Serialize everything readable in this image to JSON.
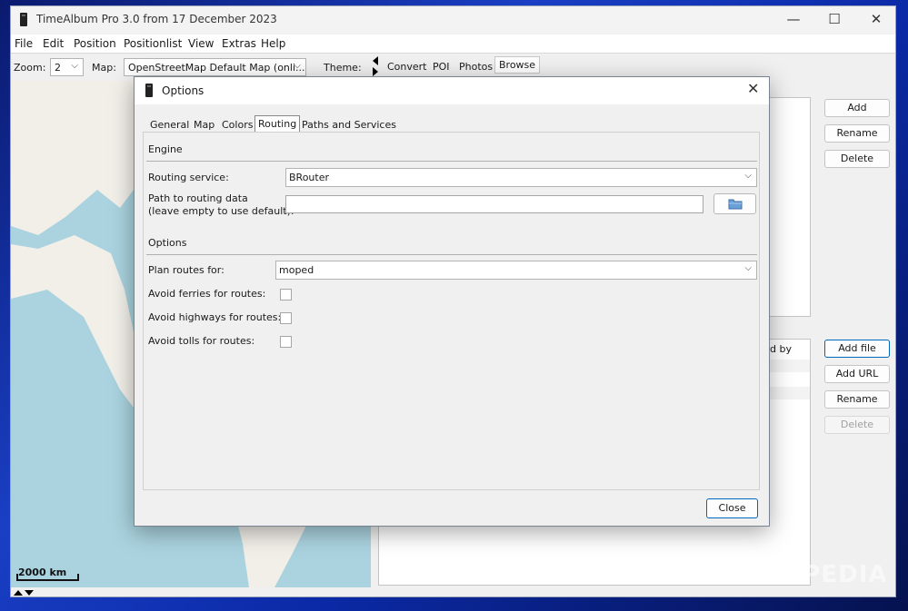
{
  "window": {
    "title": "TimeAlbum Pro 3.0 from 17 December 2023",
    "minimize_glyph": "—",
    "maximize_glyph": "☐",
    "close_glyph": "✕"
  },
  "menu": [
    "File",
    "Edit",
    "Position",
    "Positionlist",
    "View",
    "Extras",
    "Help"
  ],
  "toolbar": {
    "zoom_label": "Zoom:",
    "zoom_value": "2",
    "map_label": "Map:",
    "map_value": "OpenStreetMap Default Map (onli...",
    "theme_label": "Theme:",
    "tabs": [
      "Convert",
      "POI",
      "Photos",
      "Browse"
    ],
    "active_tab": "Browse"
  },
  "map": {
    "scale": "2000 km"
  },
  "right_panel": {
    "top_buttons": [
      "Add",
      "Rename",
      "Delete"
    ],
    "bottom_buttons": [
      "Add file",
      "Add URL",
      "Rename",
      "Delete"
    ],
    "column_partial": "d by"
  },
  "dialog": {
    "title": "Options",
    "close_glyph": "✕",
    "tabs": [
      "General",
      "Map",
      "Colors",
      "Routing",
      "Paths and Services"
    ],
    "active_tab": "Routing",
    "engine": {
      "section": "Engine",
      "routing_service_label": "Routing service:",
      "routing_service_value": "BRouter",
      "path_label_line1": "Path to routing data",
      "path_label_line2": "(leave empty to use default):",
      "path_value": ""
    },
    "options": {
      "section": "Options",
      "plan_routes_label": "Plan routes for:",
      "plan_routes_value": "moped",
      "avoid_ferries": "Avoid ferries for routes:",
      "avoid_highways": "Avoid highways for routes:",
      "avoid_tolls": "Avoid tolls for routes:"
    },
    "close_button": "Close"
  },
  "watermark": "SOFTPEDIA",
  "colors": {
    "accent": "#0067c0",
    "map_water": "#aad3df",
    "map_land": "#f2efe9"
  }
}
